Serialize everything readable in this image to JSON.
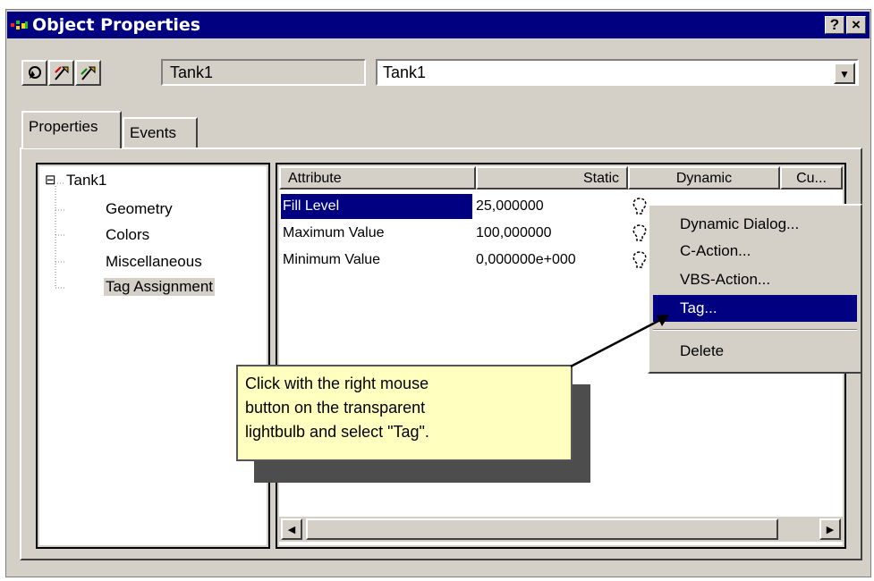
{
  "window": {
    "title": "Object Properties",
    "help_label": "?",
    "close_label": "×"
  },
  "toolbar": {
    "object_name": "Tank1",
    "combo_value": "Tank1"
  },
  "tabs": [
    {
      "label": "Properties"
    },
    {
      "label": "Events"
    }
  ],
  "tree": {
    "root": "Tank1",
    "expander": "⊟",
    "children": [
      "Geometry",
      "Colors",
      "Miscellaneous",
      "Tag Assignment"
    ]
  },
  "grid": {
    "headers": [
      "Attribute",
      "Static",
      "Dynamic",
      "Cu..."
    ],
    "rows": [
      {
        "attribute": "Fill Level",
        "static": "25,000000"
      },
      {
        "attribute": "Maximum Value",
        "static": "100,000000"
      },
      {
        "attribute": "Minimum Value",
        "static": "0,000000e+000"
      }
    ]
  },
  "context_menu": {
    "items": [
      "Dynamic Dialog...",
      "C-Action...",
      "VBS-Action...",
      "Tag...",
      "Delete"
    ],
    "selected": "Tag..."
  },
  "callout": {
    "lines": [
      "Click with the right mouse",
      "button on the transparent",
      "lightbulb and select \"Tag\"."
    ]
  },
  "colors": {
    "title_bar": "#000080",
    "selection": "#000080",
    "face": "#d4d0c8",
    "callout_bg": "#ffffc0"
  }
}
